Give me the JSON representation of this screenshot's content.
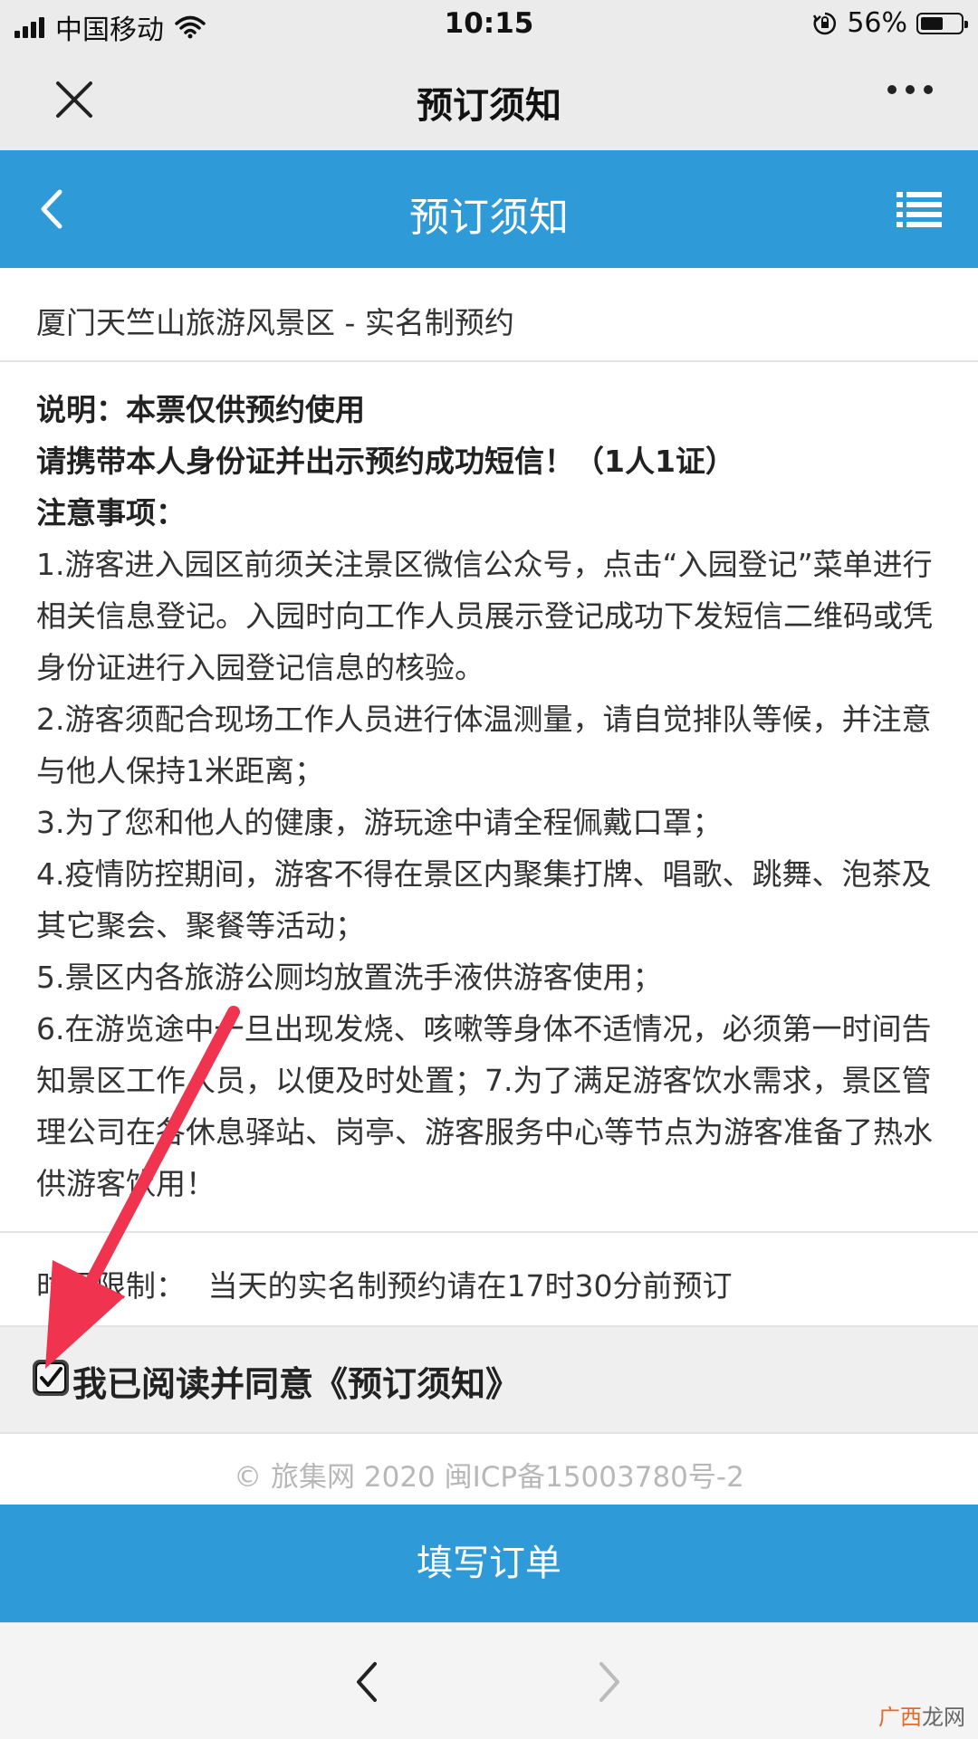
{
  "status": {
    "carrier": "中国移动",
    "time": "10:15",
    "battery": "56%",
    "battery_level": 0.56
  },
  "wechat_header": {
    "title": "预订须知",
    "close_icon": "close-icon",
    "more_icon": "more-dots-icon"
  },
  "app_header": {
    "title": "预订须知",
    "back_icon": "chevron-left-icon",
    "menu_icon": "list-icon"
  },
  "venue": "厦门天竺山旅游风景区 - 实名制预约",
  "notice": {
    "lines": [
      "说明：本票仅供预约使用",
      "请携带本人身份证并出示预约成功短信！（1人1证）",
      "注意事项："
    ],
    "items": [
      "1.游客进入园区前须关注景区微信公众号，点击“入园登记”菜单进行相关信息登记。入园时向工作人员展示登记成功下发短信二维码或凭身份证进行入园登记信息的核验。",
      "2.游客须配合现场工作人员进行体温测量，请自觉排队等候，并注意与他人保持1米距离；",
      "3.为了您和他人的健康，游玩途中请全程佩戴口罩；",
      "4.疫情防控期间，游客不得在景区内聚集打牌、唱歌、跳舞、泡茶及其它聚会、聚餐等活动；",
      "5.景区内各旅游公厕均放置洗手液供游客使用；",
      "6.在游览途中一旦出现发烧、咳嗽等身体不适情况，必须第一时间告知景区工作人员，以便及时处置；7.为了满足游客饮水需求，景区管理公司在各休息驿站、岗亭、游客服务中心等节点为游客准备了热水供游客饮用！"
    ]
  },
  "time_limit": {
    "label": "时间限制：",
    "value": "当天的实名制预约请在17时30分前预订"
  },
  "agreement": {
    "label": "我已阅读并同意《预订须知》",
    "checked": true
  },
  "footer": "© 旅集网 2020 闽ICP备15003780号-2",
  "submit_label": "填写订单",
  "browser_nav": {
    "prev_icon": "chevron-left-icon",
    "next_icon": "chevron-right-icon"
  },
  "watermark": {
    "accent": "广西",
    "rest": "龙网"
  },
  "colors": {
    "brand_blue": "#2e9ad8",
    "annotation_arrow": "#f0334e"
  }
}
